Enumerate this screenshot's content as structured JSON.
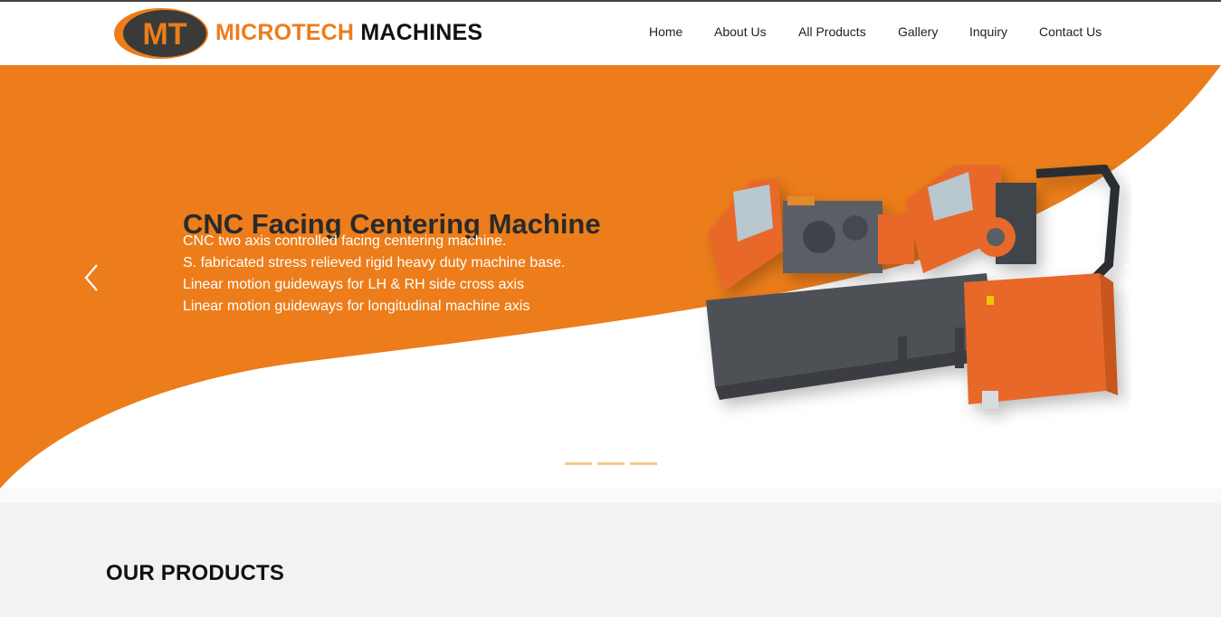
{
  "brand": {
    "initials": "MT",
    "name_part1": "MICROTECH",
    "name_part2": "MACHINES"
  },
  "nav": {
    "items": [
      {
        "label": "Home"
      },
      {
        "label": "About Us"
      },
      {
        "label": "All Products"
      },
      {
        "label": "Gallery"
      },
      {
        "label": "Inquiry"
      },
      {
        "label": "Contact Us"
      }
    ]
  },
  "hero": {
    "title": "CNC Facing Centering Machine",
    "features": [
      "CNC two axis controlled facing centering machine.",
      "S. fabricated stress relieved rigid heavy duty machine base.",
      "Linear motion guideways for LH & RH side cross axis",
      "Linear motion guideways for longitudinal machine axis"
    ],
    "slide_count": 3,
    "active_slide": 1,
    "prev_icon": "chevron-left-icon",
    "next_icon": "chevron-right-icon"
  },
  "products": {
    "heading": "OUR PRODUCTS"
  },
  "colors": {
    "accent": "#ec7d1a",
    "dark": "#2a2a2a",
    "section_bg": "#f2f2f2"
  }
}
